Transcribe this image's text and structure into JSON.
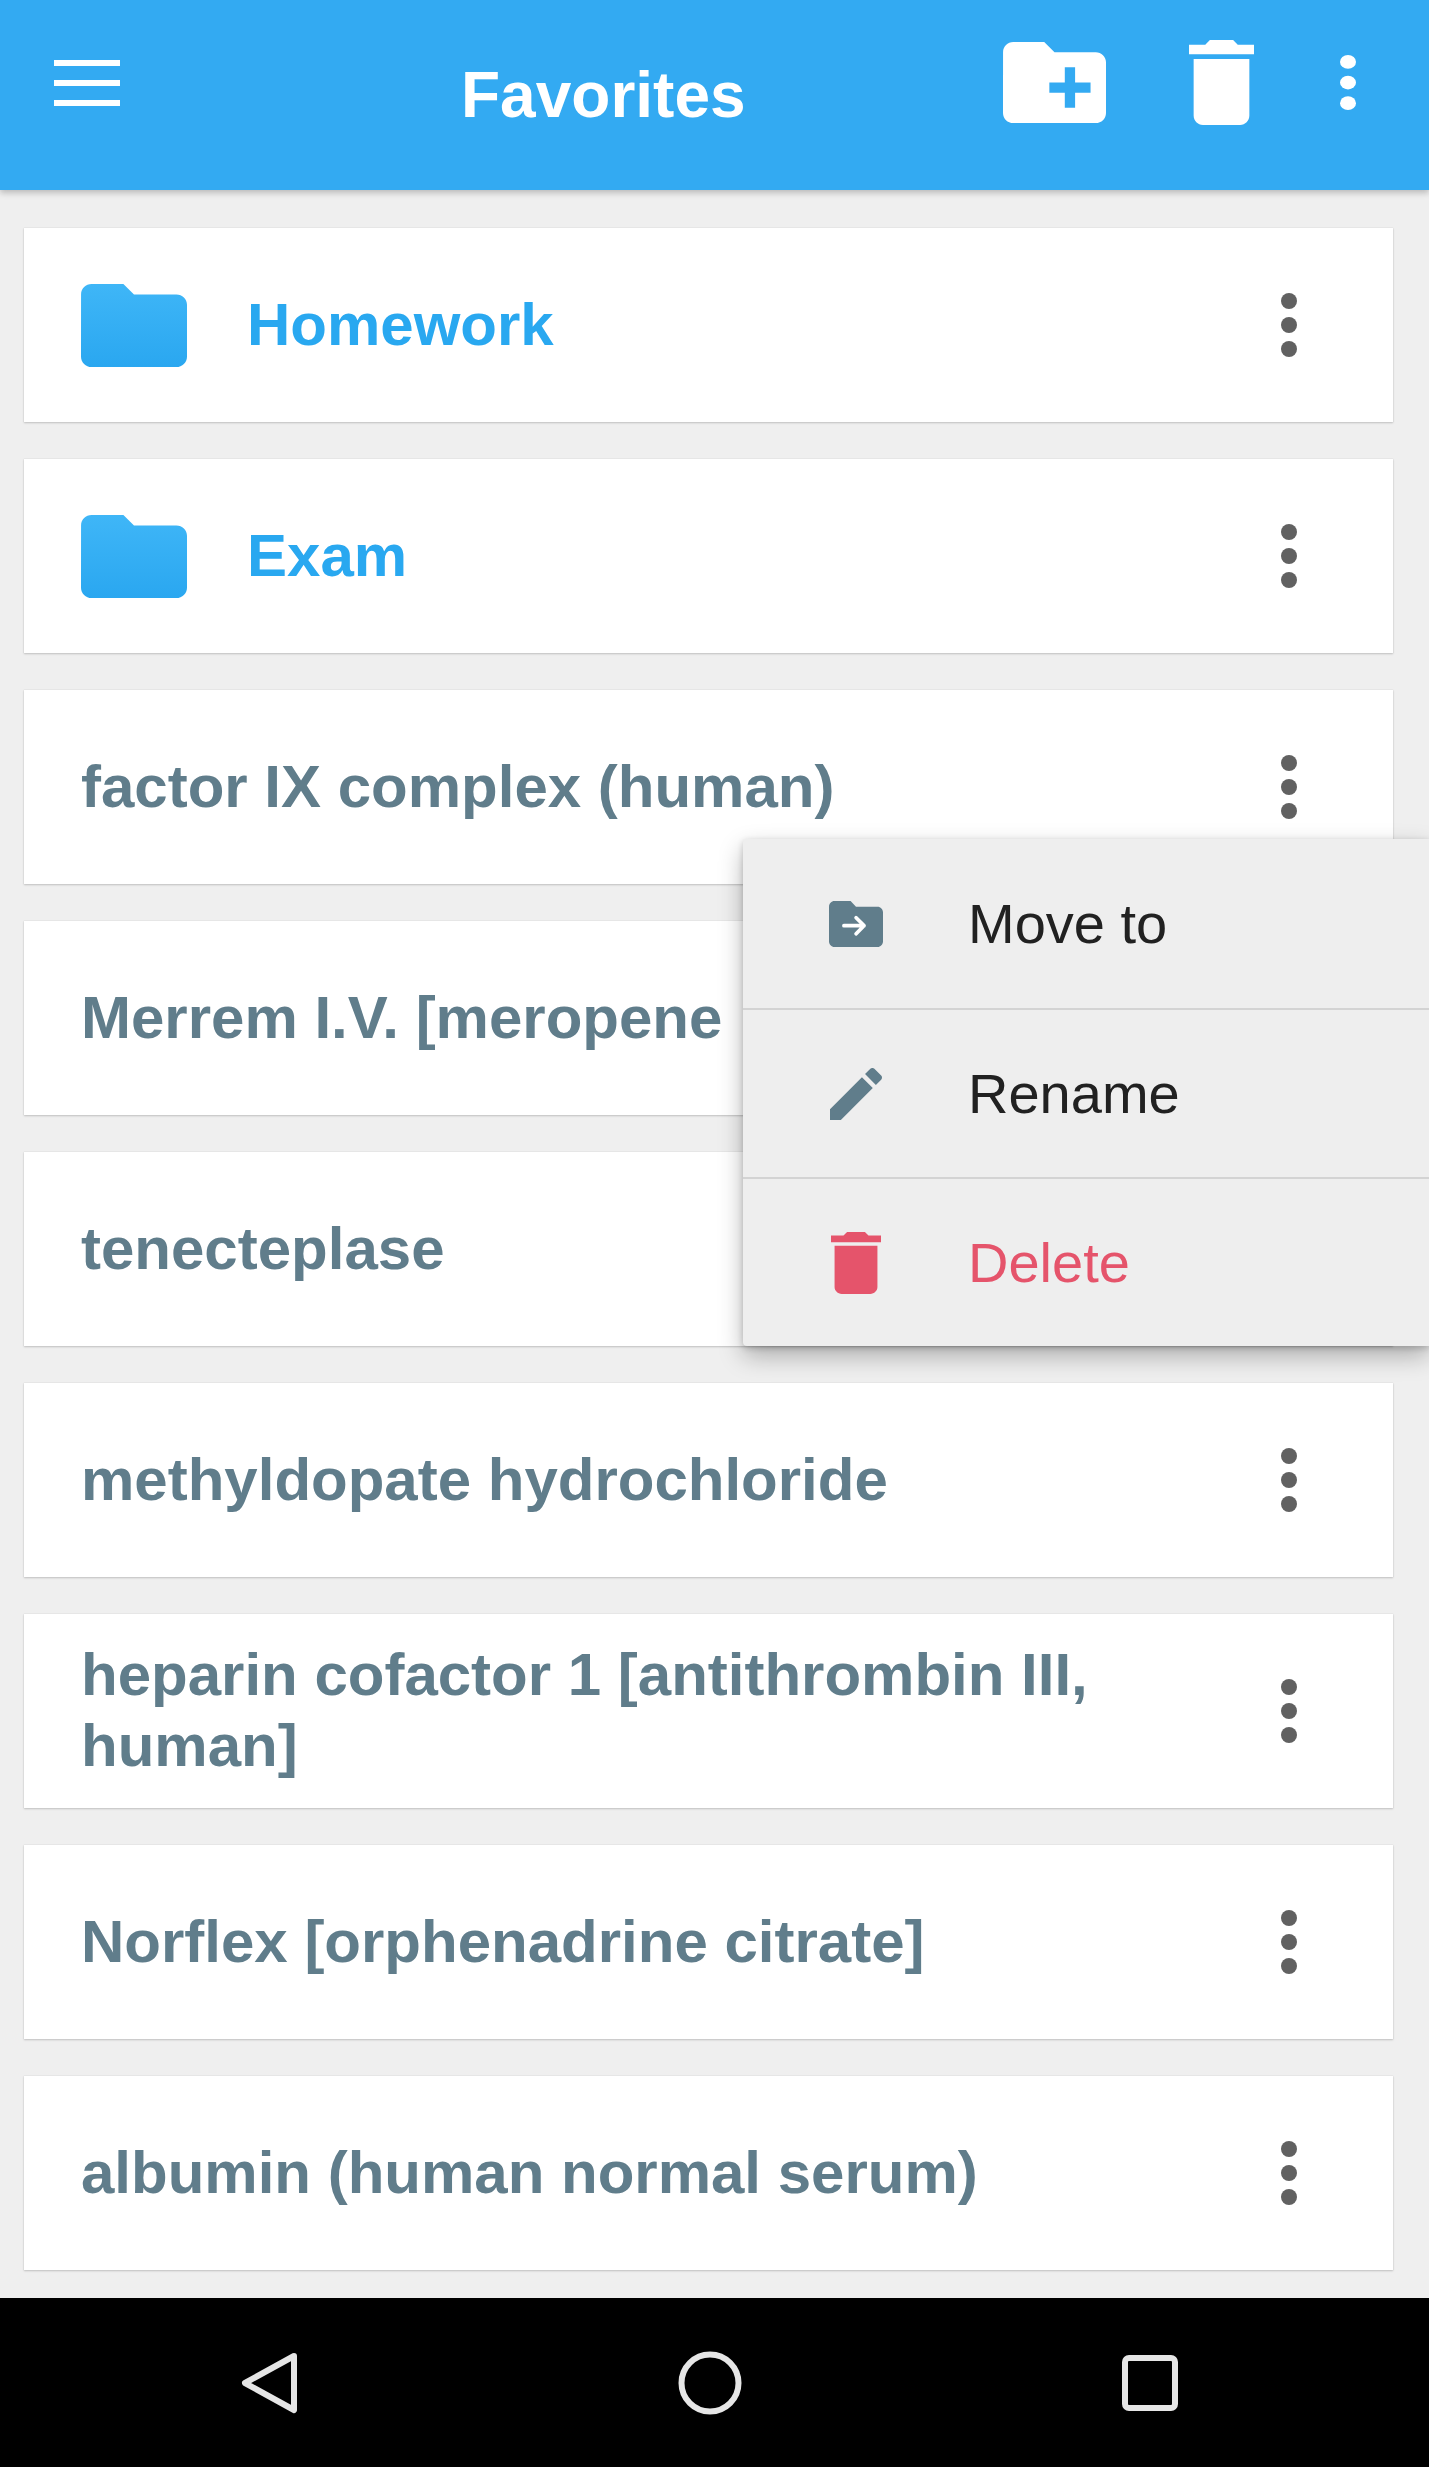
{
  "app_bar": {
    "title": "Favorites"
  },
  "items": [
    {
      "kind": "folder",
      "name": "Homework"
    },
    {
      "kind": "folder",
      "name": "Exam"
    },
    {
      "kind": "entry",
      "name": "factor IX complex (human)",
      "context_menu": [
        {
          "kind": "move",
          "label": "Move to"
        },
        {
          "kind": "rename",
          "label": "Rename"
        },
        {
          "kind": "delete",
          "label": "Delete"
        }
      ]
    },
    {
      "kind": "entry",
      "name": "Merrem I.V. [meropene"
    },
    {
      "kind": "entry",
      "name": "tenecteplase"
    },
    {
      "kind": "entry",
      "name": "methyldopate hydrochloride"
    },
    {
      "kind": "entry",
      "name": "heparin cofactor 1 [antithrombin III, human]"
    },
    {
      "kind": "entry",
      "name": "Norflex [orphenadrine citrate]"
    },
    {
      "kind": "entry",
      "name": "albumin (human normal serum)"
    }
  ]
}
